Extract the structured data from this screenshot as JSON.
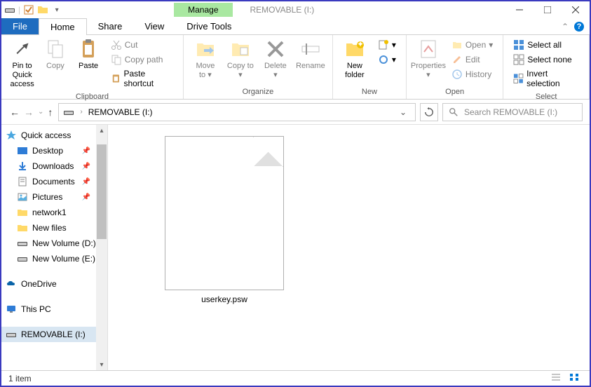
{
  "titlebar": {
    "context_tab": "Manage",
    "title": "REMOVABLE (I:)"
  },
  "tabs": {
    "file": "File",
    "home": "Home",
    "share": "Share",
    "view": "View",
    "drive_tools": "Drive Tools"
  },
  "ribbon": {
    "clipboard": {
      "label": "Clipboard",
      "pin": "Pin to Quick access",
      "copy": "Copy",
      "paste": "Paste",
      "cut": "Cut",
      "copy_path": "Copy path",
      "paste_shortcut": "Paste shortcut"
    },
    "organize": {
      "label": "Organize",
      "move_to": "Move to",
      "copy_to": "Copy to",
      "delete": "Delete",
      "rename": "Rename"
    },
    "new": {
      "label": "New",
      "new_folder": "New folder"
    },
    "open": {
      "label": "Open",
      "properties": "Properties",
      "open": "Open",
      "edit": "Edit",
      "history": "History"
    },
    "select": {
      "label": "Select",
      "select_all": "Select all",
      "select_none": "Select none",
      "invert": "Invert selection"
    }
  },
  "address": {
    "location": "REMOVABLE (I:)",
    "search_placeholder": "Search REMOVABLE (I:)"
  },
  "nav": {
    "quick_access": "Quick access",
    "desktop": "Desktop",
    "downloads": "Downloads",
    "documents": "Documents",
    "pictures": "Pictures",
    "network1": "network1",
    "new_files": "New files",
    "new_vol_d": "New Volume (D:)",
    "new_vol_e": "New Volume (E:)",
    "onedrive": "OneDrive",
    "this_pc": "This PC",
    "removable": "REMOVABLE (I:)"
  },
  "content": {
    "file1": "userkey.psw"
  },
  "status": {
    "text": "1 item"
  }
}
